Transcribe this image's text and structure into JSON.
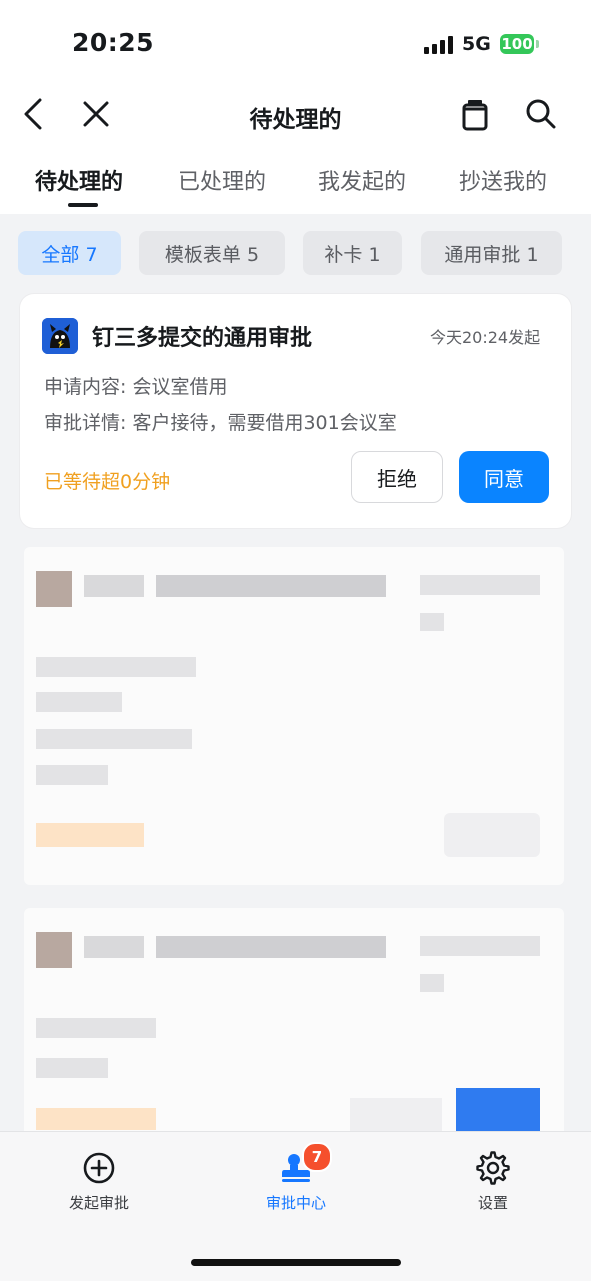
{
  "status": {
    "time": "20:25",
    "network": "5G",
    "battery": "100"
  },
  "nav": {
    "title": "待处理的"
  },
  "tabs": [
    {
      "label": "待处理的",
      "active": true
    },
    {
      "label": "已处理的"
    },
    {
      "label": "我发起的"
    },
    {
      "label": "抄送我的"
    }
  ],
  "filters": [
    {
      "label": "全部 7",
      "active": true
    },
    {
      "label": "模板表单 5"
    },
    {
      "label": "补卡 1"
    },
    {
      "label": "通用审批 1"
    }
  ],
  "card": {
    "title": "钉三多提交的通用审批",
    "time": "今天20:24发起",
    "lines": [
      "申请内容: 会议室借用",
      "审批详情: 客户接待，需要借用301会议室"
    ],
    "wait": "已等待超0分钟",
    "reject_label": "拒绝",
    "agree_label": "同意"
  },
  "tabbar": [
    {
      "label": "发起审批",
      "icon": "plus-circle-icon"
    },
    {
      "label": "审批中心",
      "icon": "approval-stamp-icon",
      "active": true,
      "badge": "7"
    },
    {
      "label": "设置",
      "icon": "gear-icon"
    }
  ]
}
